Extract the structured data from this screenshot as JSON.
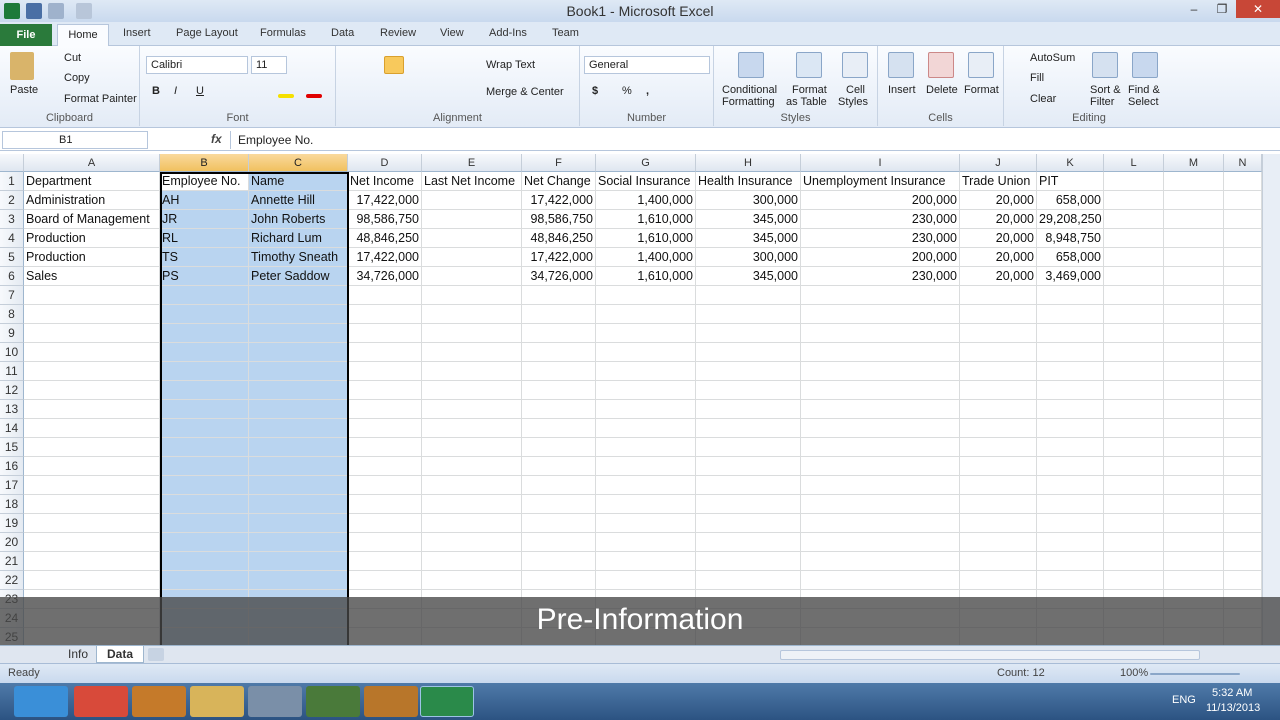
{
  "window": {
    "title": "Book1 - Microsoft Excel",
    "minimize": "–",
    "restore": "❐",
    "close": "✕"
  },
  "tabs": {
    "file": "File",
    "home": "Home",
    "others": [
      "Insert",
      "Page Layout",
      "Formulas",
      "Data",
      "Review",
      "View",
      "Add-Ins",
      "Team"
    ]
  },
  "ribbon": {
    "clipboard": {
      "paste": "Paste",
      "cut": "Cut",
      "copy": "Copy",
      "format_painter": "Format Painter",
      "label": "Clipboard"
    },
    "font": {
      "name": "Calibri",
      "size": "11",
      "bold": "B",
      "italic": "I",
      "underline": "U",
      "label": "Font"
    },
    "alignment": {
      "wrap": "Wrap Text",
      "merge": "Merge & Center",
      "label": "Alignment"
    },
    "number": {
      "format": "General",
      "currency": "$",
      "percent": "%",
      "comma": ",",
      "label": "Number"
    },
    "styles": {
      "conditional": "Conditional",
      "conditional2": "Formatting",
      "format_as": "Format",
      "format_as2": "as Table",
      "cell": "Cell",
      "cell2": "Styles",
      "label": "Styles"
    },
    "cells": {
      "insert": "Insert",
      "delete": "Delete",
      "format": "Format",
      "label": "Cells"
    },
    "editing": {
      "autosum": "AutoSum",
      "fill": "Fill",
      "clear": "Clear",
      "sort": "Sort &",
      "sort2": "Filter",
      "find": "Find &",
      "find2": "Select",
      "label": "Editing"
    }
  },
  "formula_bar": {
    "name_box": "B1",
    "fx": "fx",
    "value": "Employee No."
  },
  "columns": [
    "A",
    "B",
    "C",
    "D",
    "E",
    "F",
    "G",
    "H",
    "I",
    "J",
    "K",
    "L",
    "M",
    "N"
  ],
  "rows": [
    "1",
    "2",
    "3",
    "4",
    "5",
    "6",
    "7",
    "8",
    "9",
    "10",
    "11",
    "12",
    "13",
    "14",
    "15",
    "16",
    "17",
    "18",
    "19",
    "20",
    "21",
    "22",
    "23",
    "24",
    "25"
  ],
  "cells": {
    "r1": [
      "Department",
      "Employee No.",
      "Name",
      "Net Income",
      "Last Net Income",
      "Net Change",
      "Social Insurance",
      "Health Insurance",
      "Unemployment Insurance",
      "Trade Union",
      "PIT"
    ],
    "r2": [
      "Administration",
      "AH",
      "Annette Hill",
      "17,422,000",
      "",
      "17,422,000",
      "1,400,000",
      "300,000",
      "200,000",
      "20,000",
      "658,000"
    ],
    "r3": [
      "Board of Management",
      "JR",
      "John Roberts",
      "98,586,750",
      "",
      "98,586,750",
      "1,610,000",
      "345,000",
      "230,000",
      "20,000",
      "29,208,250"
    ],
    "r4": [
      "Production",
      "RL",
      "Richard Lum",
      "48,846,250",
      "",
      "48,846,250",
      "1,610,000",
      "345,000",
      "230,000",
      "20,000",
      "8,948,750"
    ],
    "r5": [
      "Production",
      "TS",
      "Timothy Sneath",
      "17,422,000",
      "",
      "17,422,000",
      "1,400,000",
      "300,000",
      "200,000",
      "20,000",
      "658,000"
    ],
    "r6": [
      "Sales",
      "PS",
      "Peter Saddow",
      "34,726,000",
      "",
      "34,726,000",
      "1,610,000",
      "345,000",
      "230,000",
      "20,000",
      "3,469,000"
    ]
  },
  "overlay": "Pre-Information",
  "sheets": [
    "Info",
    "Data"
  ],
  "status": {
    "ready": "Ready",
    "count": "Count: 12",
    "zoom": "100%"
  },
  "clock": {
    "time": "5:32 AM",
    "date": "11/13/2013",
    "lang": "ENG"
  }
}
